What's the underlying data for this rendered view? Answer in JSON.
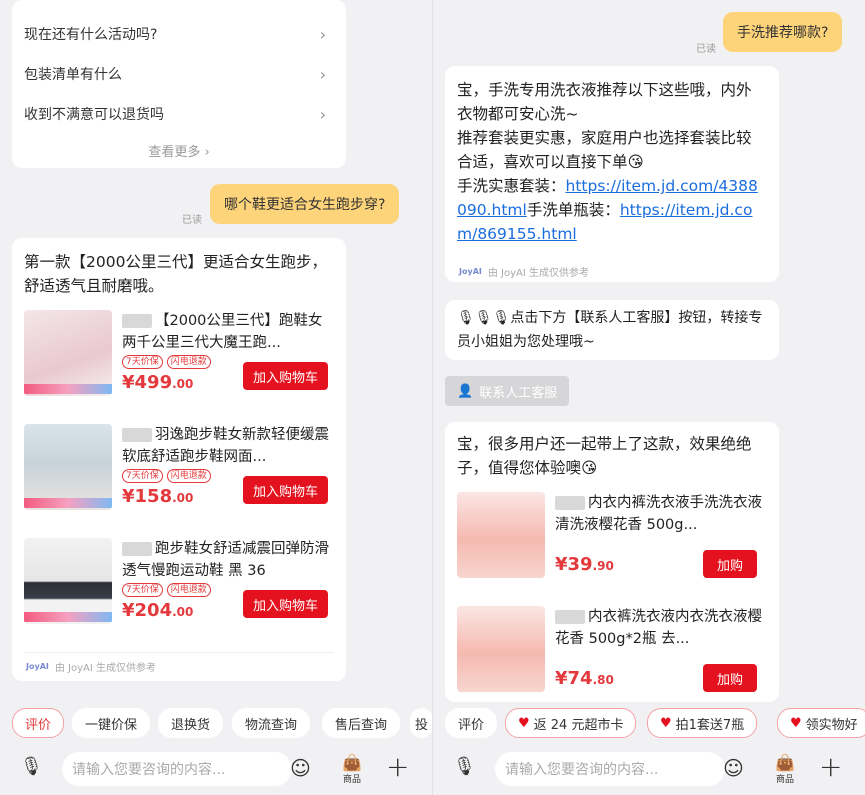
{
  "left": {
    "faq": {
      "items": [
        "现在还有什么活动吗?",
        "包装清单有什么",
        "收到不满意可以退货吗"
      ],
      "more": "查看更多 ›"
    },
    "user_msg": "哪个鞋更适合女生跑步穿?",
    "read_label": "已读",
    "reply": {
      "text": "第一款【2000公里三代】更适合女生跑步，舒适透气且耐磨哦。",
      "products": [
        {
          "title": "【2000公里三代】跑鞋女两千公里三代大魔王跑...",
          "tags": [
            "7天价保",
            "闪电退款"
          ],
          "price_main": "¥499",
          "price_dec": ".00",
          "button": "加入购物车"
        },
        {
          "title": "羽逸跑步鞋女新款轻便缓震软底舒适跑步鞋网面...",
          "tags": [
            "7天价保",
            "闪电退款"
          ],
          "price_main": "¥158",
          "price_dec": ".00",
          "button": "加入购物车"
        },
        {
          "title": "跑步鞋女舒适减震回弹防滑透气慢跑运动鞋 黑 36",
          "tags": [
            "7天价保",
            "闪电退款"
          ],
          "price_main": "¥204",
          "price_dec": ".00",
          "button": "加入购物车"
        }
      ],
      "footer": "由 JoyAI 生成仅供参考",
      "logo": "JoyAI"
    },
    "chips": [
      "评价",
      "一键价保",
      "退换货",
      "物流查询",
      "售后查询",
      "投"
    ],
    "input_placeholder": "请输入您要咨询的内容...",
    "goods_label": "商品"
  },
  "right": {
    "user_msg": "手洗推荐哪款?",
    "read_label": "已读",
    "reply1": {
      "line1": "宝，手洗专用洗衣液推荐以下这些哦，内外衣物都可安心洗~",
      "line2": "推荐套装更实惠，家庭用户也选择套装比较合适，喜欢可以直接下单😘",
      "label1": "手洗实惠套装：",
      "link1": "https://item.jd.com/4388090.html",
      "label2": "手洗单瓶装：",
      "link2": "https://item.jd.com/869155.html",
      "footer": "由 JoyAI 生成仅供参考",
      "logo": "JoyAI"
    },
    "reply2": "🎙🎙🎙点击下方【联系人工客服】按钮，转接专员小姐姐为您处理哦~",
    "agent_button": "联系人工客服",
    "reply3": {
      "text": "宝，很多用户还一起带上了这款，效果绝绝子，值得您体验噢😘",
      "products": [
        {
          "title": "内衣内裤洗衣液手洗洗衣液清洗液樱花香 500g...",
          "price_main": "¥39",
          "price_dec": ".90",
          "button": "加购"
        },
        {
          "title": "内衣裤洗衣液内衣洗衣液樱花香 500g*2瓶 去...",
          "price_main": "¥74",
          "price_dec": ".80",
          "button": "加购"
        }
      ]
    },
    "chips": [
      "评价",
      "返 24 元超市卡",
      "拍1套送7瓶",
      "领实物好"
    ],
    "input_placeholder": "请输入您要咨询的内容...",
    "goods_label": "商品"
  }
}
